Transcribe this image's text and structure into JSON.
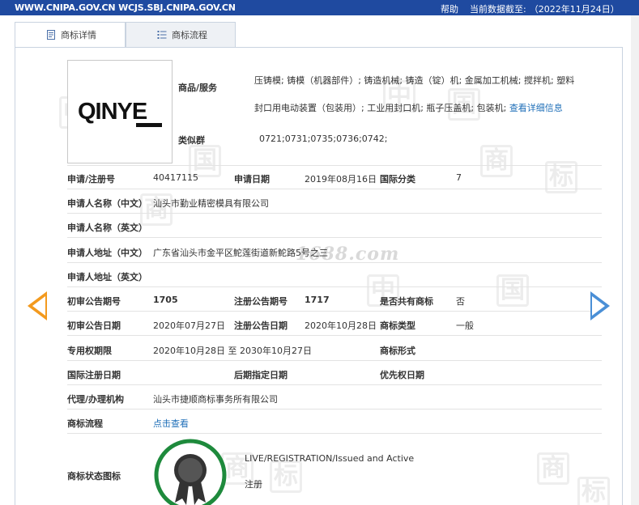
{
  "topbar": {
    "site": "WWW.CNIPA.GOV.CN WCJS.SBJ.CNIPA.GOV.CN",
    "help": "帮助",
    "date_label": "当前数据截至:",
    "date_value": "（2022年11月24日）"
  },
  "tabs": [
    {
      "label": "商标详情",
      "active": true
    },
    {
      "label": "商标流程",
      "active": false
    }
  ],
  "logo_text": "QINYE",
  "goods": {
    "label": "商品/服务",
    "text": "压铸模; 铸模（机器部件）; 铸造机械; 铸造（锭）机; 金属加工机械; 搅拌机; 塑料封口用电动装置（包装用）; 工业用封口机; 瓶子压盖机; 包装机;",
    "link": "查看详细信息"
  },
  "similar": {
    "label": "类似群",
    "value": "0721;0731;0735;0736;0742;"
  },
  "fields": {
    "reg_no_label": "申请/注册号",
    "reg_no": "40417115",
    "app_date_label": "申请日期",
    "app_date": "2019年08月16日",
    "intl_class_label": "国际分类",
    "intl_class": "7",
    "applicant_cn_label": "申请人名称（中文）",
    "applicant_cn": "汕头市勤业精密模具有限公司",
    "applicant_en_label": "申请人名称（英文）",
    "addr_cn_label": "申请人地址（中文）",
    "addr_cn": "广东省汕头市金平区鮀莲街道新鮀路5号之三",
    "addr_en_label": "申请人地址（英文）",
    "prelim_no_label": "初审公告期号",
    "prelim_no": "1705",
    "reg_pub_no_label": "注册公告期号",
    "reg_pub_no": "1717",
    "shared_label": "是否共有商标",
    "shared": "否",
    "prelim_date_label": "初审公告日期",
    "prelim_date": "2020年07月27日",
    "reg_pub_date_label": "注册公告日期",
    "reg_pub_date": "2020年10月28日",
    "tm_type_label": "商标类型",
    "tm_type": "一般",
    "exclusive_label": "专用权期限",
    "exclusive": "2020年10月28日 至 2030年10月27日",
    "tm_form_label": "商标形式",
    "intl_reg_date_label": "国际注册日期",
    "later_date_label": "后期指定日期",
    "priority_label": "优先权日期",
    "agent_label": "代理/办理机构",
    "agent": "汕头市捷顺商标事务所有限公司",
    "process_label": "商标流程",
    "process_link": "点击查看",
    "status_icon_label": "商标状态图标",
    "status_en": "LIVE/REGISTRATION/Issued and Active",
    "status_cn": "注册"
  },
  "watermark": {
    "text": "1688.com",
    "char1": "中",
    "char2": "国",
    "char3": "商",
    "char4": "标"
  }
}
